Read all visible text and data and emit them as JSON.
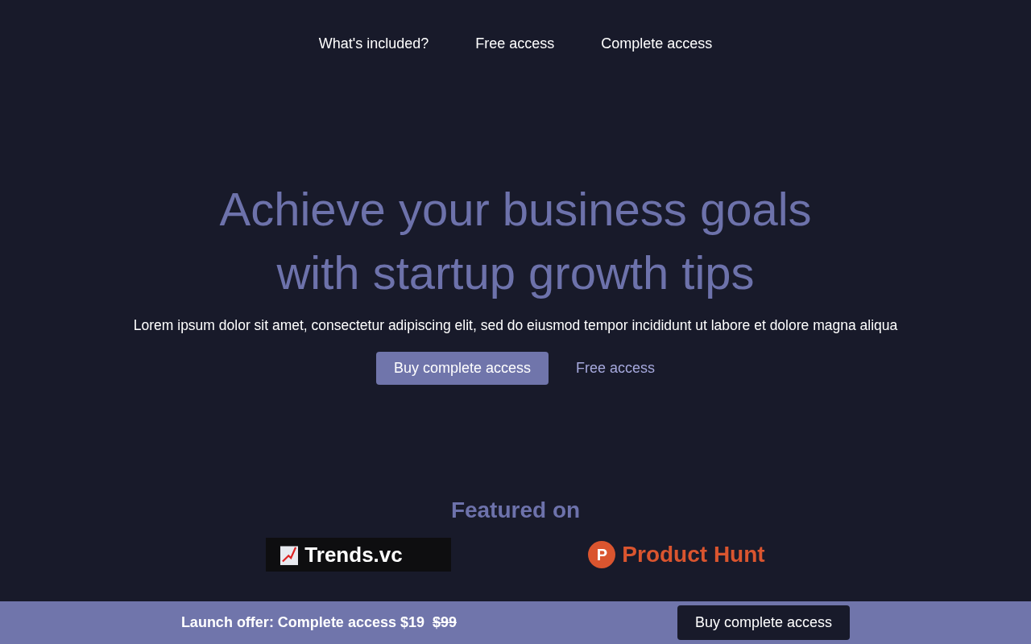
{
  "nav": {
    "links": [
      "What's included?",
      "Free access",
      "Complete access"
    ]
  },
  "hero": {
    "title": "Achieve your business goals with startup growth tips",
    "subtitle": "Lorem ipsum dolor sit amet, consectetur adipiscing elit, sed do eiusmod tempor incididunt ut labore et dolore magna aliqua",
    "primary_button": "Buy complete access",
    "secondary_link": "Free access"
  },
  "featured": {
    "heading": "Featured on",
    "logos": [
      {
        "kind": "trends",
        "text": "Trends.vc"
      },
      {
        "kind": "producthunt",
        "text": "Product Hunt",
        "mark": "P"
      }
    ]
  },
  "offer_bar": {
    "label": "Launch offer: Complete access $19",
    "old_price": "$99",
    "button": "Buy complete access"
  }
}
